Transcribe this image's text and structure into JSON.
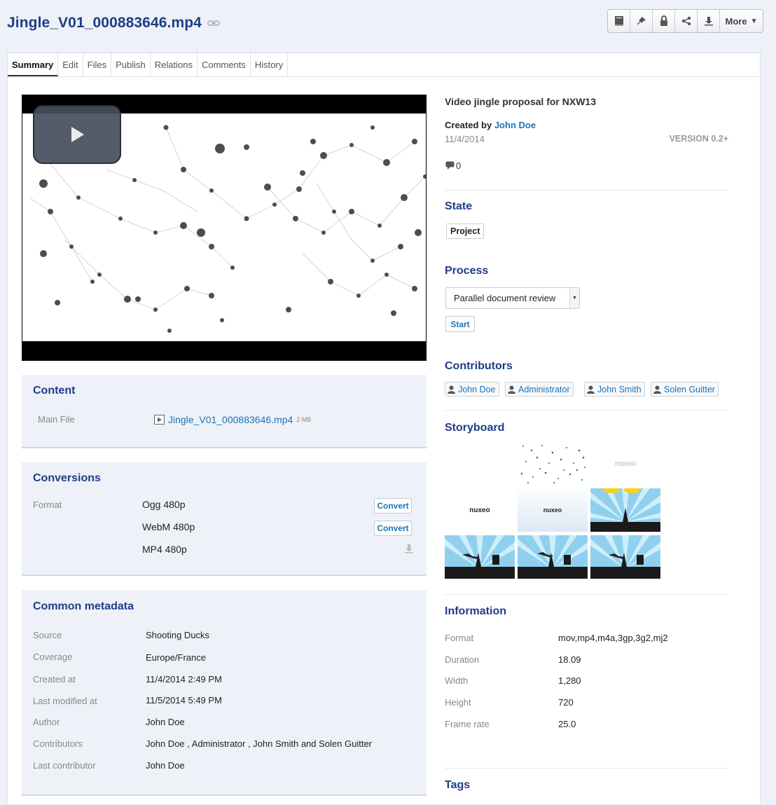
{
  "document": {
    "title": "Jingle_V01_000883646.mp4",
    "description": "Video jingle proposal for NXW13",
    "created_by_label": "Created by",
    "author": "John Doe",
    "date": "11/4/2014",
    "version": "VERSION 0.2+",
    "comment_count": "0"
  },
  "toolbar": {
    "more_label": "More",
    "icons": [
      "book-icon",
      "pin-icon",
      "lock-icon",
      "share-icon",
      "download-icon"
    ]
  },
  "tabs": [
    "Summary",
    "Edit",
    "Files",
    "Publish",
    "Relations",
    "Comments",
    "History"
  ],
  "content": {
    "title": "Content",
    "main_file_label": "Main File",
    "main_file_name": "Jingle_V01_000883646.mp4",
    "main_file_size": "2 MB"
  },
  "conversions": {
    "title": "Conversions",
    "format_label": "Format",
    "rows": [
      {
        "name": "Ogg 480p",
        "action": "Convert"
      },
      {
        "name": "WebM 480p",
        "action": "Convert"
      },
      {
        "name": "MP4 480p",
        "action": ""
      }
    ]
  },
  "metadata": {
    "title": "Common metadata",
    "rows": [
      {
        "label": "Source",
        "value": "Shooting Ducks"
      },
      {
        "label": "Coverage",
        "value": "Europe/France"
      },
      {
        "label": "Created at",
        "value": "11/4/2014 2:49 PM"
      },
      {
        "label": "Last modified at",
        "value": "11/5/2014 5:49 PM"
      },
      {
        "label": "Author",
        "value": "John Doe"
      },
      {
        "label": "Contributors",
        "value": "John Doe , Administrator , John Smith and Solen Guitter"
      },
      {
        "label": "Last contributor",
        "value": "John Doe"
      }
    ]
  },
  "state": {
    "title": "State",
    "value": "Project"
  },
  "process": {
    "title": "Process",
    "selected": "Parallel document review",
    "start_label": "Start"
  },
  "contributors": {
    "title": "Contributors",
    "items": [
      "John Doe",
      "Administrator",
      "John Smith",
      "Solen Guitter"
    ]
  },
  "storyboard": {
    "title": "Storyboard",
    "frame_labels": [
      "nuxeo",
      "nuxeo",
      "nuxeo"
    ]
  },
  "information": {
    "title": "Information",
    "rows": [
      {
        "label": "Format",
        "value": "mov,mp4,m4a,3gp,3g2,mj2"
      },
      {
        "label": "Duration",
        "value": "18.09"
      },
      {
        "label": "Width",
        "value": "1,280"
      },
      {
        "label": "Height",
        "value": "720"
      },
      {
        "label": "Frame rate",
        "value": "25.0"
      }
    ]
  },
  "tags": {
    "title": "Tags"
  },
  "colors": {
    "accent": "#1f3c88",
    "link": "#1a73b8",
    "panel_bg": "#eef1f7"
  }
}
